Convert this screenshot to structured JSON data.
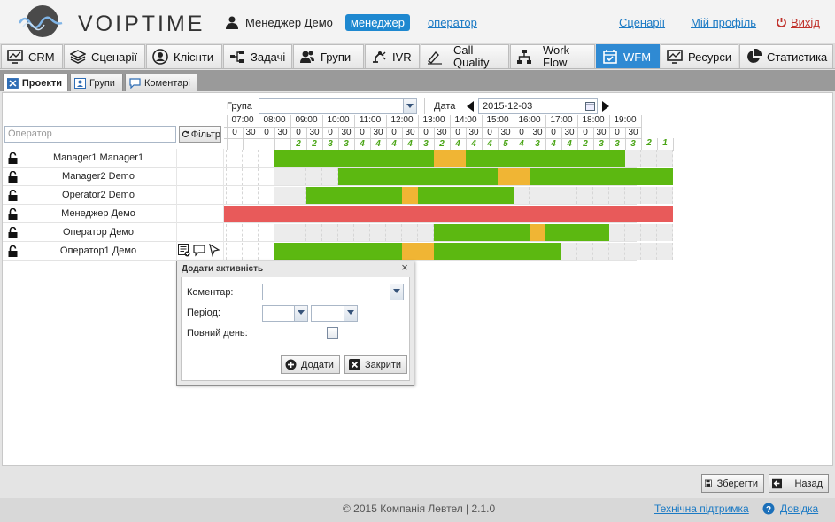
{
  "brand": {
    "logo_text": "VOIPTIME"
  },
  "header": {
    "user_name": "Менеджер Демо",
    "role_active": "менеджер",
    "role_other": "оператор",
    "links": {
      "scenarios": "Сценарії",
      "profile": "Мій профіль",
      "exit": "Вихід"
    }
  },
  "nav": {
    "crm": "CRM",
    "scenarios": "Сценарії",
    "clients": "Клієнти",
    "tasks": "Задачі",
    "groups": "Групи",
    "ivr": "IVR",
    "call_quality_1": "Call",
    "call_quality_2": "Quality",
    "workflow_1": "Work",
    "workflow_2": "Flow",
    "wfm": "WFM",
    "resources": "Ресурси",
    "statistics": "Статистика"
  },
  "subtabs": {
    "projects": "Проекти",
    "groups": "Групи",
    "comments": "Коментарі"
  },
  "filter": {
    "group_label": "Група",
    "group_value": "",
    "date_label": "Дата",
    "date_value": "2015-12-03",
    "operator_placeholder": "Оператор",
    "filter_button": "Фільтр"
  },
  "schedule": {
    "hours": [
      "07:00",
      "08:00",
      "09:00",
      "10:00",
      "11:00",
      "12:00",
      "13:00",
      "14:00",
      "15:00",
      "16:00",
      "17:00",
      "18:00",
      "19:00"
    ],
    "counts": [
      "",
      "",
      "",
      "",
      "2",
      "2",
      "3",
      "3",
      "4",
      "4",
      "4",
      "4",
      "3",
      "2",
      "4",
      "4",
      "4",
      "5",
      "4",
      "3",
      "4",
      "4",
      "2",
      "3",
      "3",
      "3",
      "2",
      "1"
    ],
    "rows": [
      {
        "name": "Manager1 Manager1",
        "cells": "wwwwggggggggggyyggggggggggwww"
      },
      {
        "name": "Manager2 Demo",
        "cells": "wwwwwwwwggggggggggyyggggggggg"
      },
      {
        "name": "Operator2 Demo",
        "cells": "wwwwwwggggggyggggggwwwwwwwwww"
      },
      {
        "name": "Менеджер Демо",
        "cells": "rrrrrrrrrrrrrrrrrrrrrrrrrrrrr"
      },
      {
        "name": "Оператор Демо",
        "cells": "wwwwwwwwwwwwwwggggggyggggwwww"
      },
      {
        "name": "Оператор1 Демо",
        "cells": "wwwwggggggggyyggggggggwwwwwww"
      }
    ]
  },
  "dialog": {
    "title": "Додати активність",
    "comment_label": "Коментар:",
    "period_label": "Період:",
    "fullday_label": "Повний день:",
    "add_button": "Додати",
    "close_button": "Закрити"
  },
  "actions": {
    "save": "Зберегти",
    "back": "Назад"
  },
  "footer": {
    "copyright": "© 2015 Компанія Левтел | 2.1.0",
    "support": "Технічна підтримка",
    "help": "Довідка"
  }
}
